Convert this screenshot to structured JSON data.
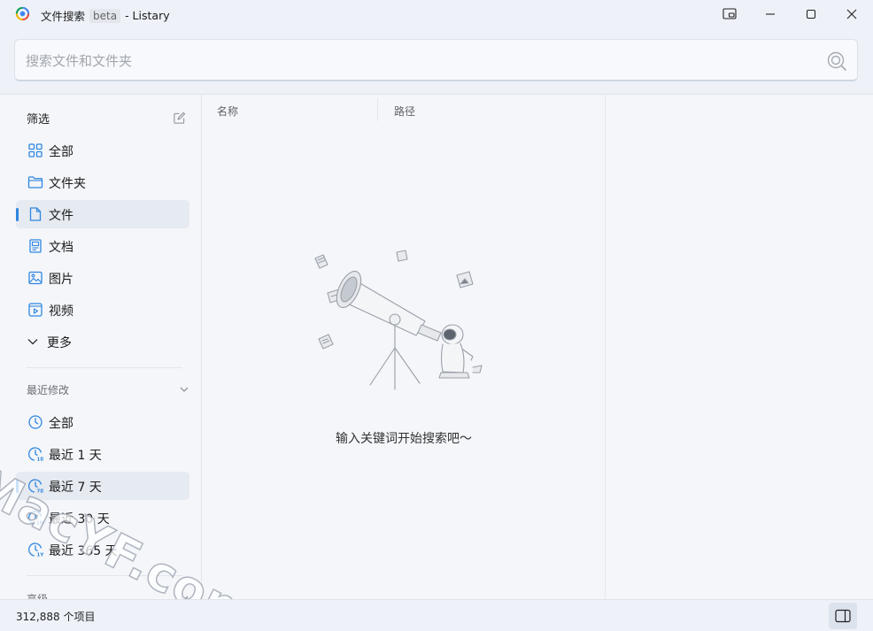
{
  "window": {
    "title": "文件搜索",
    "badge": "beta",
    "app_suffix": "- Listary"
  },
  "search": {
    "placeholder": "搜索文件和文件夹",
    "value": ""
  },
  "sidebar": {
    "filter_header": "筛选",
    "filters": [
      {
        "label": "全部",
        "icon": "grid-icon",
        "active": false
      },
      {
        "label": "文件夹",
        "icon": "folder-icon",
        "active": false
      },
      {
        "label": "文件",
        "icon": "file-icon",
        "active": true
      },
      {
        "label": "文档",
        "icon": "document-icon",
        "active": false
      },
      {
        "label": "图片",
        "icon": "image-icon",
        "active": false
      },
      {
        "label": "视频",
        "icon": "video-icon",
        "active": false
      },
      {
        "label": "更多",
        "icon": "chevron-down-icon",
        "active": false
      }
    ],
    "recent_header": "最近修改",
    "recent": [
      {
        "label": "全部",
        "icon": "clock-icon",
        "active": false
      },
      {
        "label": "最近 1 天",
        "icon": "clock-1d-icon",
        "active": false
      },
      {
        "label": "最近 7 天",
        "icon": "clock-7d-icon",
        "active": true
      },
      {
        "label": "最近 30 天",
        "icon": "clock-1m-icon",
        "active": false
      },
      {
        "label": "最近 365 天",
        "icon": "clock-1y-icon",
        "active": false
      }
    ],
    "advanced_header": "高级"
  },
  "results": {
    "columns": [
      "名称",
      "路径"
    ],
    "empty_message": "输入关键词开始搜索吧～"
  },
  "status": {
    "item_count": "312,888 个项目"
  },
  "watermark": "MacYF.com",
  "colors": {
    "accent": "#2f86e0",
    "background": "#f4f6fa",
    "chrome": "#eef2f8"
  }
}
